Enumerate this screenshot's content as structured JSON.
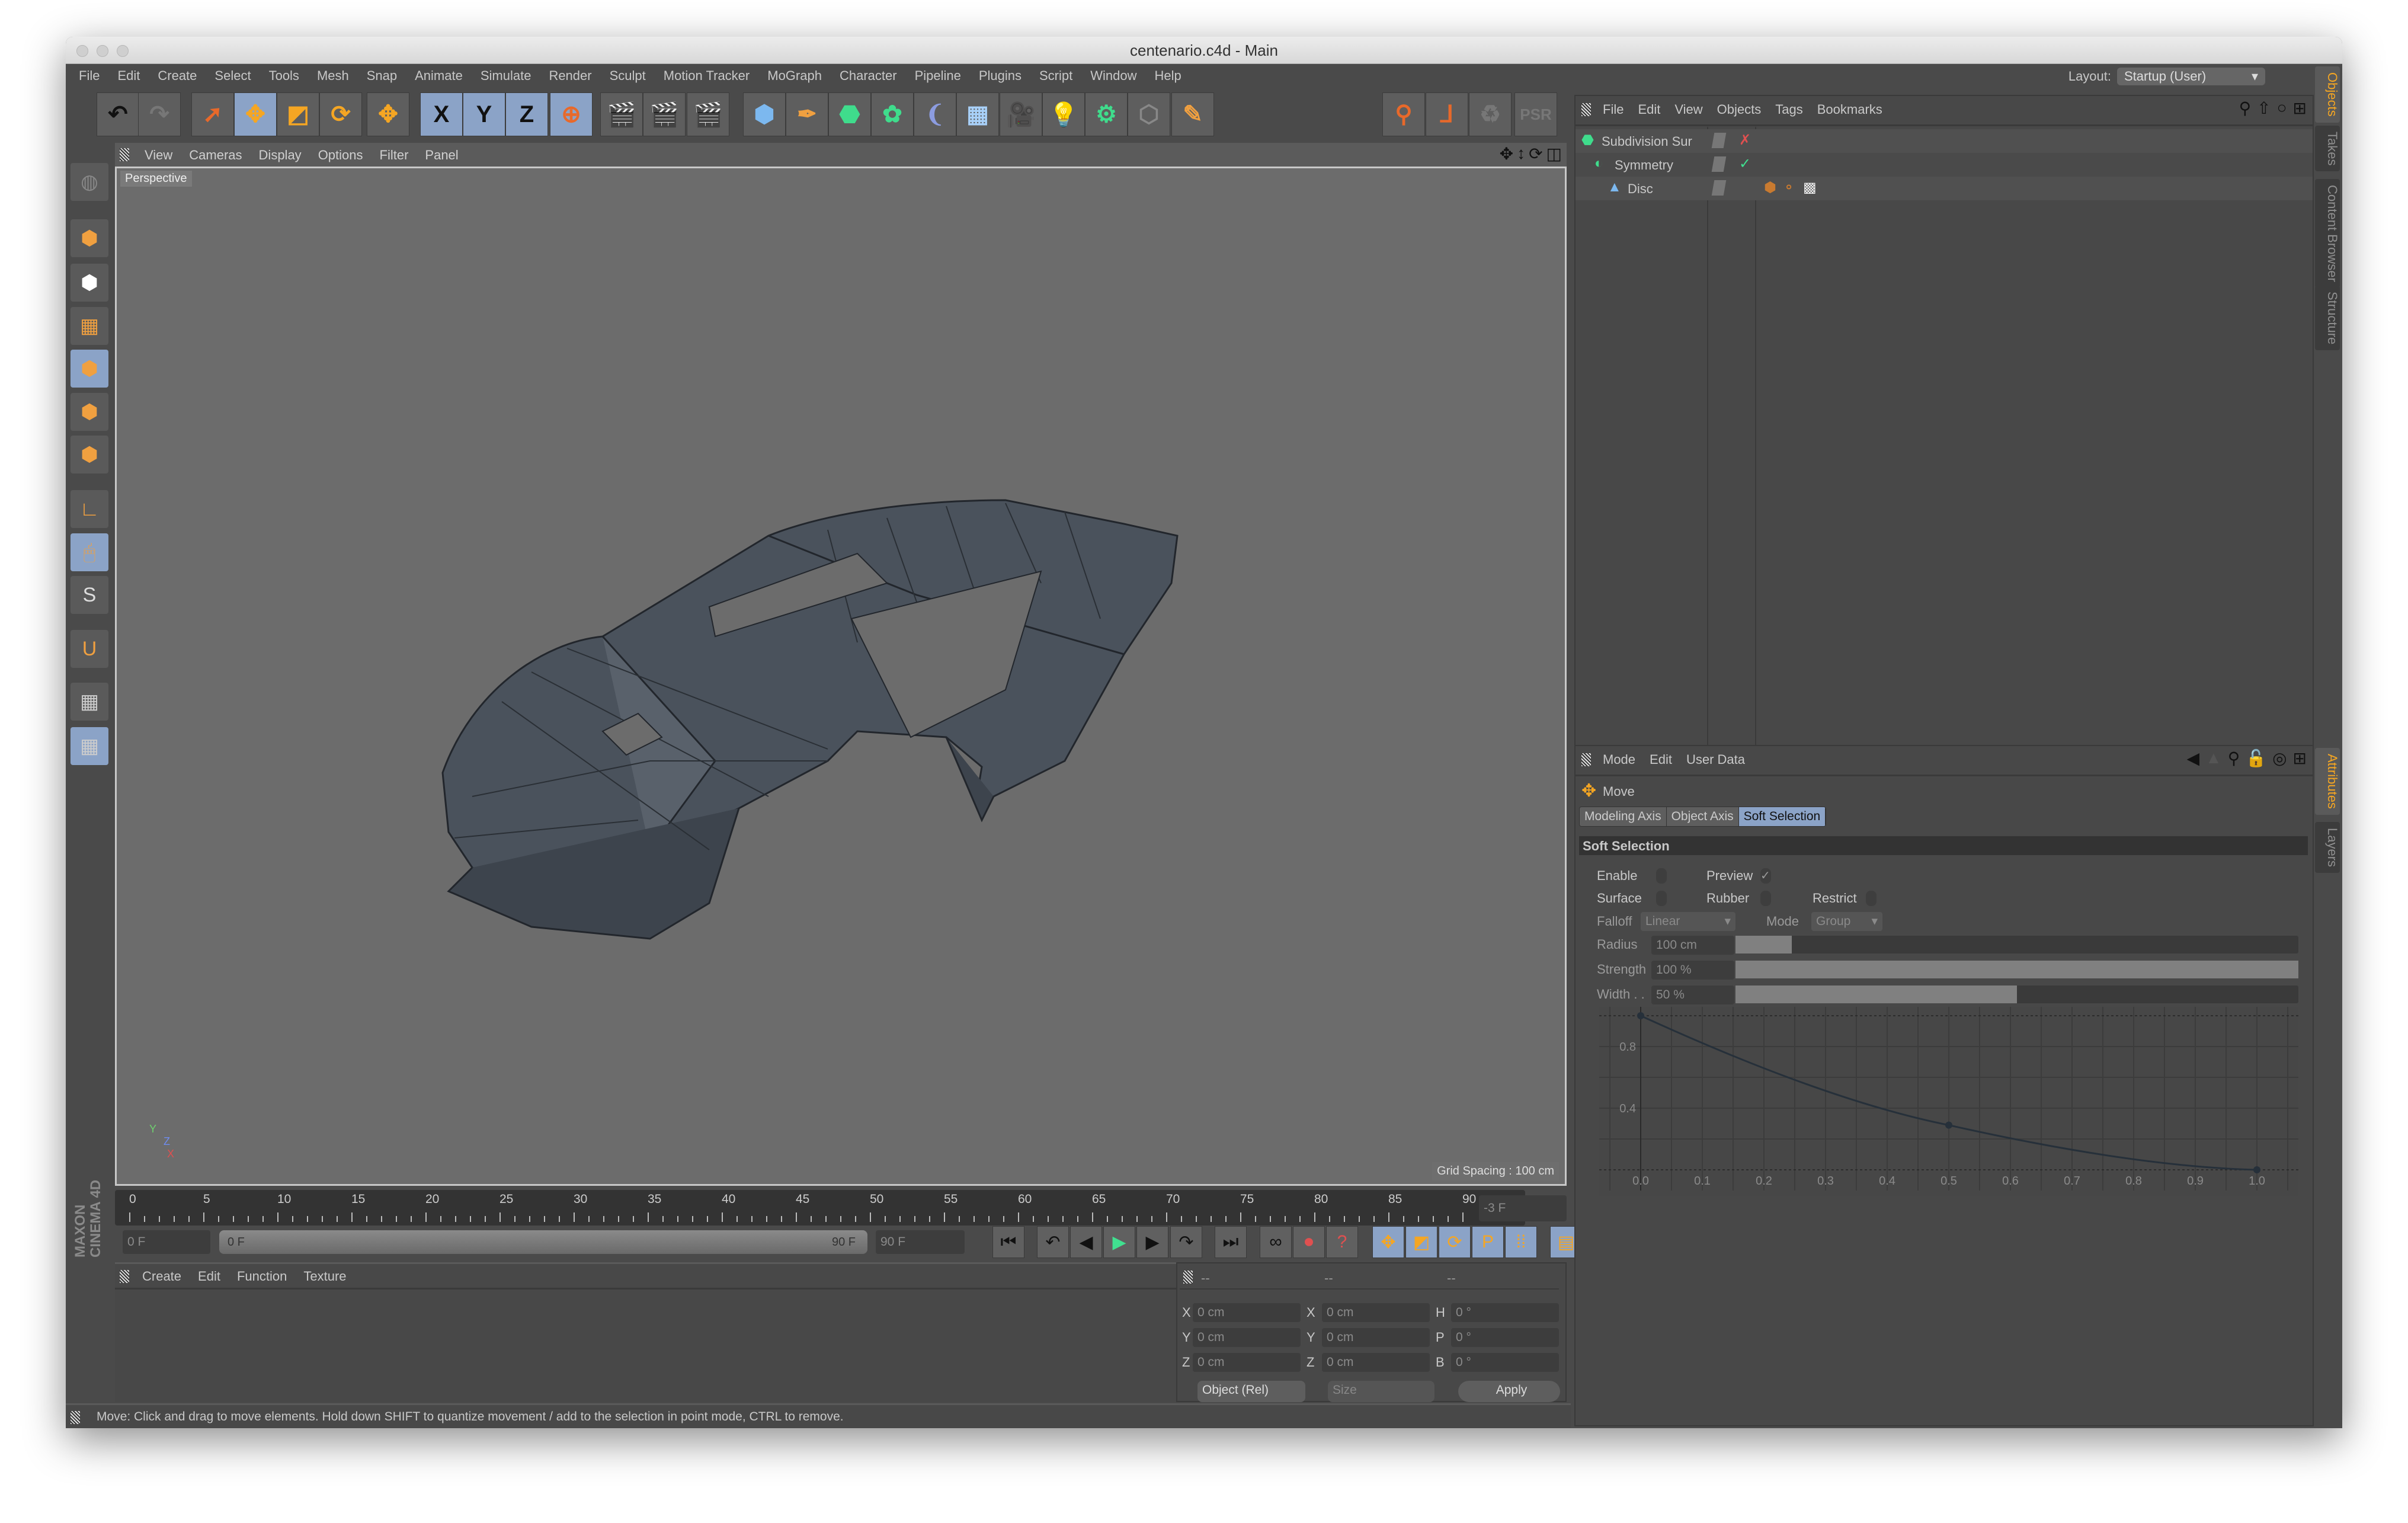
{
  "window": {
    "title": "centenario.c4d - Main"
  },
  "menu": [
    "File",
    "Edit",
    "Create",
    "Select",
    "Tools",
    "Mesh",
    "Snap",
    "Animate",
    "Simulate",
    "Render",
    "Sculpt",
    "Motion Tracker",
    "MoGraph",
    "Character",
    "Pipeline",
    "Plugins",
    "Script",
    "Window",
    "Help"
  ],
  "layout": {
    "label": "Layout:",
    "value": "Startup (User)"
  },
  "toolbar": [
    {
      "icon": "undo-icon",
      "glyph": "↶",
      "color": "#111",
      "active": false
    },
    {
      "icon": "redo-icon",
      "glyph": "↷",
      "color": "#777",
      "active": false
    },
    {
      "icon": "live-selection-icon",
      "glyph": "➚",
      "color": "#e8692a",
      "active": false
    },
    {
      "icon": "move-icon",
      "glyph": "✥",
      "color": "#f5a623",
      "active": true
    },
    {
      "icon": "scale-icon",
      "glyph": "◩",
      "color": "#f5a623",
      "active": false
    },
    {
      "icon": "rotate-icon",
      "glyph": "⟳",
      "color": "#f5a623",
      "active": false
    },
    {
      "icon": "last-tool-move-icon",
      "glyph": "✥",
      "color": "#f5a623",
      "active": false
    },
    {
      "icon": "x-axis-lock-icon",
      "glyph": "X",
      "color": "#111",
      "active": true
    },
    {
      "icon": "y-axis-lock-icon",
      "glyph": "Y",
      "color": "#111",
      "active": true
    },
    {
      "icon": "z-axis-lock-icon",
      "glyph": "Z",
      "color": "#111",
      "active": true
    },
    {
      "icon": "world-coordinates-icon",
      "glyph": "⊕",
      "color": "#e8692a",
      "active": true
    },
    {
      "icon": "render-view-icon",
      "glyph": "🎬",
      "color": "#e8692a",
      "active": false
    },
    {
      "icon": "render-to-picture-viewer-icon",
      "glyph": "🎬",
      "color": "#e8692a",
      "active": false
    },
    {
      "icon": "render-settings-icon",
      "glyph": "🎬",
      "color": "#e8692a",
      "active": false
    },
    {
      "icon": "cube-icon",
      "glyph": "⬢",
      "color": "#7cb8ef",
      "active": false
    },
    {
      "icon": "pen-spline-icon",
      "glyph": "✒",
      "color": "#f0a040",
      "active": false
    },
    {
      "icon": "subdivision-surface-icon",
      "glyph": "⬣",
      "color": "#3fdc8c",
      "active": false
    },
    {
      "icon": "cloner-icon",
      "glyph": "✿",
      "color": "#3fdc8c",
      "active": false
    },
    {
      "icon": "deformer-bend-icon",
      "glyph": "❨",
      "color": "#8c9ce0",
      "active": false
    },
    {
      "icon": "floor-icon",
      "glyph": "▦",
      "color": "#a8d0f8",
      "active": false
    },
    {
      "icon": "camera-icon",
      "glyph": "🎥",
      "color": "#222",
      "active": false
    },
    {
      "icon": "light-icon",
      "glyph": "💡",
      "color": "#eee",
      "active": false
    },
    {
      "icon": "xpresso-icon",
      "glyph": "⚙",
      "color": "#3fdc8c",
      "active": false
    },
    {
      "icon": "character-icon",
      "glyph": "⬡",
      "color": "#888",
      "active": false
    },
    {
      "icon": "sketch-icon",
      "glyph": "✎",
      "color": "#f0a040",
      "active": false
    }
  ],
  "toolbar_right": [
    {
      "icon": "enable-axis-icon",
      "glyph": "⚲",
      "color": "#e8692a"
    },
    {
      "icon": "locked-workplane-icon",
      "glyph": "⅃",
      "color": "#e8692a"
    },
    {
      "icon": "recycle-icon",
      "glyph": "♻",
      "color": "#777"
    },
    {
      "icon": "psr-icon",
      "glyph": "PSR",
      "color": "#777"
    }
  ],
  "left_tools": [
    {
      "icon": "viewport-solo-icon",
      "glyph": "◍",
      "color": "#888",
      "active": false
    },
    {
      "icon": "make-editable-icon",
      "glyph": "⬢",
      "color": "#f0a040",
      "active": false
    },
    {
      "icon": "texture-mode-icon",
      "glyph": "⬢",
      "color": "#fff",
      "active": false
    },
    {
      "icon": "workplane-icon",
      "glyph": "▦",
      "color": "#f0a040",
      "active": false
    },
    {
      "icon": "points-mode-icon",
      "glyph": "⬢",
      "color": "#f0a040",
      "active": true
    },
    {
      "icon": "edges-mode-icon",
      "glyph": "⬢",
      "color": "#f0a040",
      "active": false
    },
    {
      "icon": "polygons-mode-icon",
      "glyph": "⬢",
      "color": "#f0a040",
      "active": false
    },
    {
      "icon": "axis-mode-icon",
      "glyph": "∟",
      "color": "#f0a040",
      "active": false
    },
    {
      "icon": "tweak-mode-icon",
      "glyph": "🖱",
      "color": "#f0a040",
      "active": true
    },
    {
      "icon": "solo-icon",
      "glyph": "S",
      "color": "#ddd",
      "active": false
    },
    {
      "icon": "snap-icon",
      "glyph": "U",
      "color": "#f0a040",
      "active": false
    },
    {
      "icon": "lock-workplane-icon",
      "glyph": "▦",
      "color": "#ccc",
      "active": false
    },
    {
      "icon": "planar-workplane-icon",
      "glyph": "▦",
      "color": "#ccc",
      "active": true
    }
  ],
  "viewport": {
    "menu": [
      "View",
      "Cameras",
      "Display",
      "Options",
      "Filter",
      "Panel"
    ],
    "camera": "Perspective",
    "grid_spacing": "Grid Spacing : 100 cm",
    "axis": [
      "Y",
      "Z",
      "X"
    ]
  },
  "timeline": {
    "ticks": [
      "0",
      "5",
      "10",
      "15",
      "20",
      "25",
      "30",
      "35",
      "40",
      "45",
      "50",
      "55",
      "60",
      "65",
      "70",
      "75",
      "80",
      "85",
      "90"
    ],
    "current_frame": "-3 F",
    "start": "0 F",
    "range_start": "0 F",
    "range_end": "90 F",
    "end": "90 F"
  },
  "playback": [
    {
      "icon": "go-to-start-icon",
      "glyph": "⏮"
    },
    {
      "icon": "previous-key-icon",
      "glyph": "↶"
    },
    {
      "icon": "previous-frame-icon",
      "glyph": "◀"
    },
    {
      "icon": "play-icon",
      "glyph": "▶"
    },
    {
      "icon": "next-frame-icon",
      "glyph": "▶"
    },
    {
      "icon": "next-key-icon",
      "glyph": "↷"
    },
    {
      "icon": "go-to-end-icon",
      "glyph": "⏭"
    },
    {
      "icon": "motion-record-icon",
      "glyph": "∞"
    },
    {
      "icon": "record-active-objects-icon",
      "glyph": "⏺"
    },
    {
      "icon": "autokeying-icon",
      "glyph": "?"
    },
    {
      "icon": "key-position-icon",
      "glyph": "✥"
    },
    {
      "icon": "key-scale-icon",
      "glyph": "◩"
    },
    {
      "icon": "key-rotation-icon",
      "glyph": "⟳"
    },
    {
      "icon": "key-parameter-icon",
      "glyph": "P"
    },
    {
      "icon": "key-pla-icon",
      "glyph": "⁞⁞"
    },
    {
      "icon": "timeline-icon",
      "glyph": "▤"
    }
  ],
  "materials": {
    "menu": [
      "Create",
      "Edit",
      "Function",
      "Texture"
    ],
    "brand": "MAXON CINEMA 4D"
  },
  "coordinates": {
    "headers": [
      "--",
      "--",
      "--"
    ],
    "rows": [
      {
        "a": "X",
        "av": "0 cm",
        "b": "X",
        "bv": "0 cm",
        "c": "H",
        "cv": "0 °"
      },
      {
        "a": "Y",
        "av": "0 cm",
        "b": "Y",
        "bv": "0 cm",
        "c": "P",
        "cv": "0 °"
      },
      {
        "a": "Z",
        "av": "0 cm",
        "b": "Z",
        "bv": "0 cm",
        "c": "B",
        "cv": "0 °"
      }
    ],
    "mode": "Object (Rel)",
    "size": "Size",
    "apply": "Apply"
  },
  "status": "Move: Click and drag to move elements. Hold down SHIFT to quantize movement / add to the selection in point mode, CTRL to remove.",
  "objects": {
    "menu": [
      "File",
      "Edit",
      "View",
      "Objects",
      "Tags",
      "Bookmarks"
    ],
    "items": [
      {
        "name": "Subdivision Sur",
        "state": "✗",
        "state_color": "#e05050"
      },
      {
        "name": "Symmetry",
        "state": "✓",
        "state_color": "#40e090"
      },
      {
        "name": "Disc",
        "state": "",
        "state_color": ""
      }
    ]
  },
  "side_tabs_top": [
    "Objects",
    "Takes",
    "Content Browser",
    "Structure"
  ],
  "side_tabs_bottom": [
    "Attributes",
    "Layers"
  ],
  "attributes": {
    "menu": [
      "Mode",
      "Edit",
      "User Data"
    ],
    "tool": "Move",
    "tabs": [
      "Modeling Axis",
      "Object Axis",
      "Soft Selection"
    ],
    "active_tab": 2,
    "section": "Soft Selection",
    "enable": {
      "label": "Enable",
      "checked": false
    },
    "preview": {
      "label": "Preview",
      "checked": true
    },
    "surface": {
      "label": "Surface",
      "checked": false
    },
    "rubber": {
      "label": "Rubber",
      "checked": false
    },
    "restrict": {
      "label": "Restrict",
      "checked": false
    },
    "falloff": {
      "label": "Falloff",
      "value": "Linear"
    },
    "mode": {
      "label": "Mode",
      "value": "Group"
    },
    "radius": {
      "label": "Radius",
      "value": "100 cm",
      "fraction": 0.1
    },
    "strength": {
      "label": "Strength",
      "value": "100 %",
      "fraction": 1.0
    },
    "width": {
      "label": "Width . .",
      "value": "50 %",
      "fraction": 0.5
    }
  },
  "chart_data": {
    "type": "line",
    "x_ticks": [
      "0.0",
      "0.1",
      "0.2",
      "0.3",
      "0.4",
      "0.5",
      "0.6",
      "0.7",
      "0.8",
      "0.9",
      "1.0"
    ],
    "y_ticks": [
      "0.4",
      "0.8"
    ],
    "xlim": [
      0,
      1
    ],
    "ylim": [
      0,
      1
    ],
    "grid": true,
    "points": [
      [
        0,
        1
      ],
      [
        0.5,
        0.29
      ],
      [
        1,
        0
      ]
    ]
  }
}
